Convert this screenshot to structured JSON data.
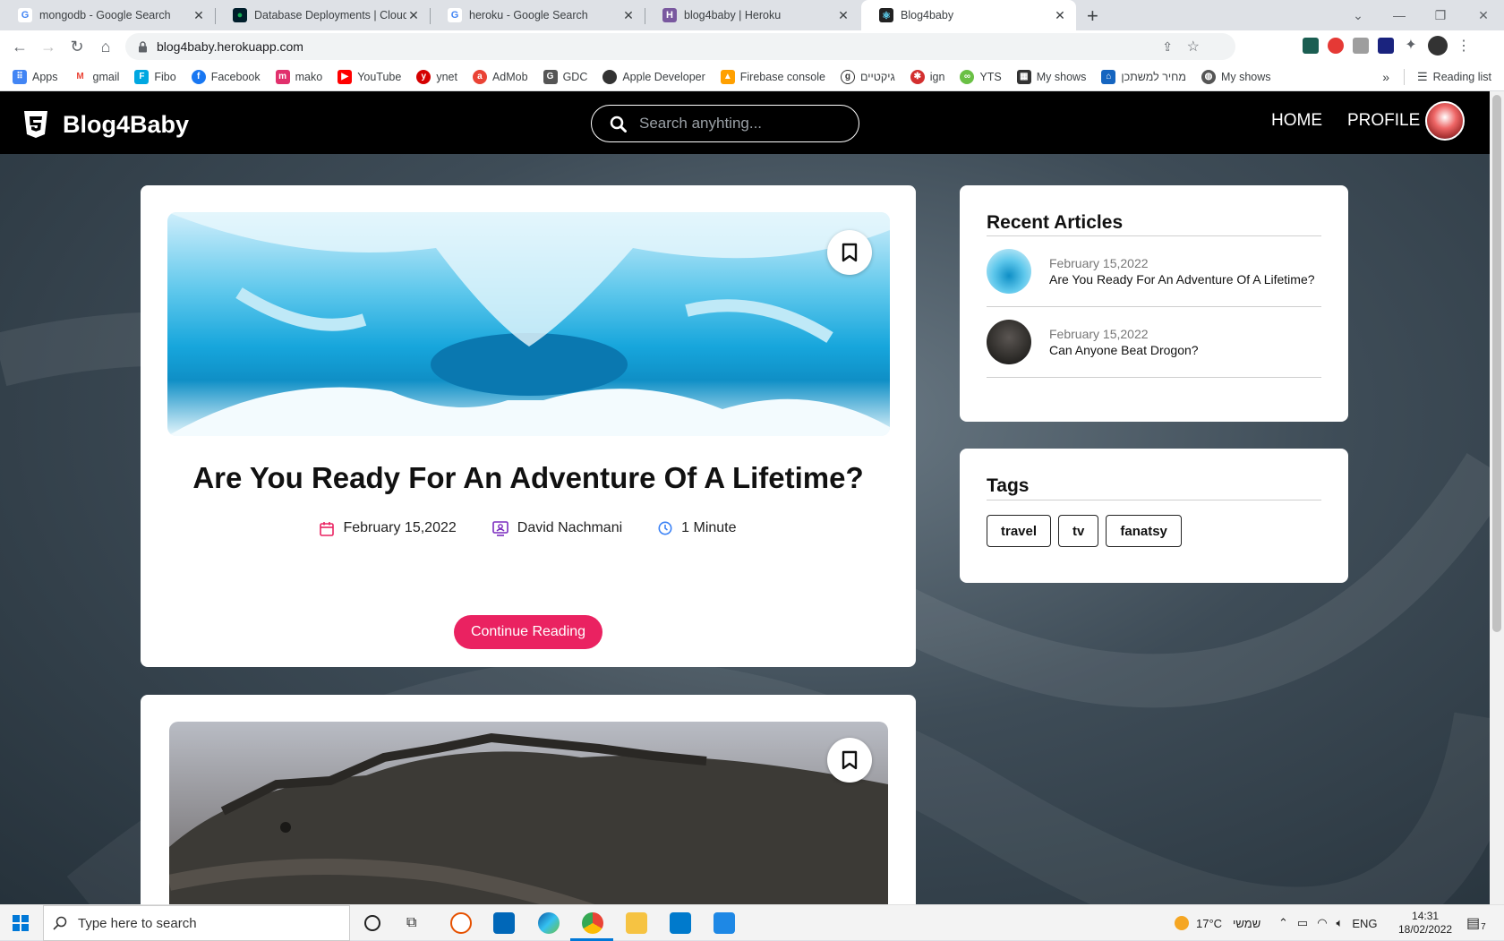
{
  "browser": {
    "tabs": [
      {
        "title": "mongodb - Google Search",
        "icon": "google-icon",
        "color": "#4285f4"
      },
      {
        "title": "Database Deployments | Cloud: M",
        "icon": "mongodb-leaf-icon",
        "color": "#13aa52"
      },
      {
        "title": "heroku - Google Search",
        "icon": "google-icon",
        "color": "#4285f4"
      },
      {
        "title": "blog4baby | Heroku",
        "icon": "heroku-icon",
        "color": "#79589f"
      },
      {
        "title": "Blog4baby",
        "icon": "react-icon",
        "color": "#222"
      }
    ],
    "url": "blog4baby.herokuapp.com",
    "bookmarks": [
      {
        "label": "Apps",
        "icon": "apps-grid-icon",
        "color": "#4285f4"
      },
      {
        "label": "gmail",
        "icon": "gmail-icon",
        "color": "#ea4335"
      },
      {
        "label": "Fibo",
        "icon": "fibo-icon",
        "color": "#00a7e1"
      },
      {
        "label": "Facebook",
        "icon": "facebook-icon",
        "color": "#1877f2"
      },
      {
        "label": "mako",
        "icon": "mako-icon",
        "color": "#e1306c"
      },
      {
        "label": "YouTube",
        "icon": "youtube-icon",
        "color": "#ff0000"
      },
      {
        "label": "ynet",
        "icon": "ynet-icon",
        "color": "#d50000"
      },
      {
        "label": "AdMob",
        "icon": "admob-icon",
        "color": "#ea4335"
      },
      {
        "label": "GDC",
        "icon": "gdc-icon",
        "color": "#555555"
      },
      {
        "label": "Apple Developer",
        "icon": "apple-icon",
        "color": "#333333"
      },
      {
        "label": "Firebase console",
        "icon": "firebase-icon",
        "color": "#ffa000"
      },
      {
        "label": "גיקטיים",
        "icon": "geektime-icon",
        "color": "#333333"
      },
      {
        "label": "ign",
        "icon": "ign-icon",
        "color": "#d32f2f"
      },
      {
        "label": "YTS",
        "icon": "yts-icon",
        "color": "#6ac045"
      },
      {
        "label": "My shows",
        "icon": "myshows-icon",
        "color": "#333333"
      },
      {
        "label": "מחיר למשתכן",
        "icon": "housing-icon",
        "color": "#1565c0"
      },
      {
        "label": "My shows",
        "icon": "globe-icon",
        "color": "#555555"
      }
    ],
    "reading_list": "Reading list"
  },
  "site": {
    "brand": "Blog4Baby",
    "search_placeholder": "Search anyhting...",
    "nav": [
      "HOME",
      "PROFILE"
    ]
  },
  "posts": [
    {
      "title": "Are You Ready For An Adventure Of A Lifetime?",
      "date": "February 15,2022",
      "author": "David Nachmani",
      "read_time": "1 Minute",
      "cta": "Continue Reading"
    }
  ],
  "sidebar": {
    "recent_title": "Recent Articles",
    "recent": [
      {
        "date": "February 15,2022",
        "title": "Are You Ready For An Adventure Of A Lifetime?"
      },
      {
        "date": "February 15,2022",
        "title": "Can Anyone Beat Drogon?"
      }
    ],
    "tags_title": "Tags",
    "tags": [
      "travel",
      "tv",
      "fanatsy"
    ]
  },
  "taskbar": {
    "search_placeholder": "Type here to search",
    "weather": "17°C",
    "weather_text": "שמשי",
    "lang": "ENG",
    "time": "14:31",
    "date": "18/02/2022",
    "notifications": "7"
  }
}
